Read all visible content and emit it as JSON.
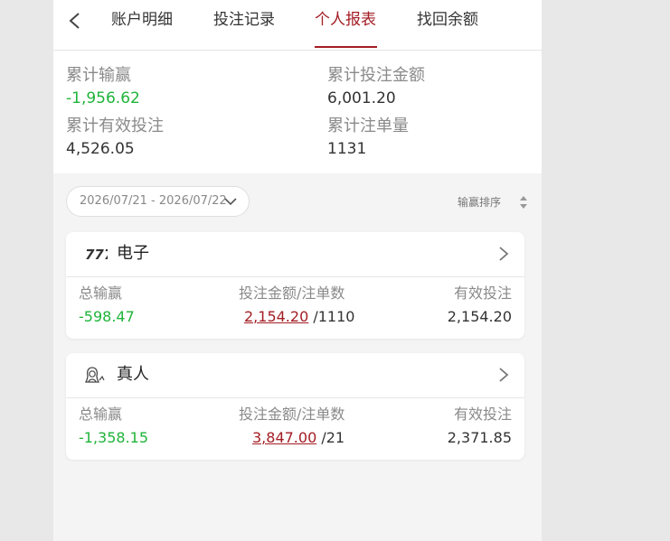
{
  "tabs": [
    {
      "label": "账户明细"
    },
    {
      "label": "投注记录"
    },
    {
      "label": "个人报表",
      "active": true
    },
    {
      "label": "找回余额"
    }
  ],
  "summary": {
    "win_loss_label": "累计输赢",
    "win_loss_value": "-1,956.62",
    "bet_amount_label": "累计投注金额",
    "bet_amount_value": "6,001.20",
    "valid_bet_label": "累计有效投注",
    "valid_bet_value": "4,526.05",
    "bet_count_label": "累计注单量",
    "bet_count_value": "1131"
  },
  "filter": {
    "date_range": "2026/07/21 - 2026/07/22",
    "sort_label": "输赢排序"
  },
  "cards": [
    {
      "name": "电子",
      "icon": "slot-777-icon",
      "total_label": "总输赢",
      "total_value": "-598.47",
      "amount_label": "投注金额/注单数",
      "amount_value": "2,154.20",
      "count_value": "/1110",
      "valid_label": "有效投注",
      "valid_value": "2,154.20"
    },
    {
      "name": "真人",
      "icon": "live-dealer-icon",
      "total_label": "总输赢",
      "total_value": "-1,358.15",
      "amount_label": "投注金额/注单数",
      "amount_value": "3,847.00",
      "count_value": "/21",
      "valid_label": "有效投注",
      "valid_value": "2,371.85"
    }
  ],
  "colors": {
    "accent": "#a31d24",
    "positive_negative": "#1fb43a"
  }
}
